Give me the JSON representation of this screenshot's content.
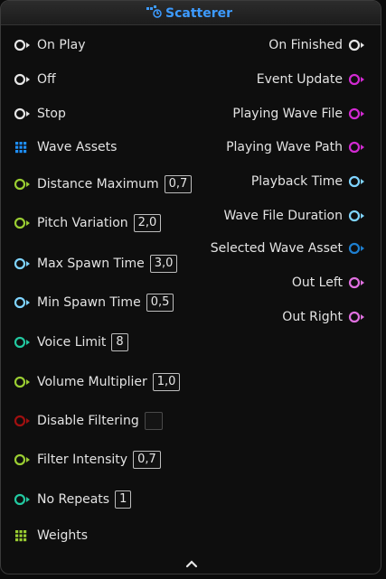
{
  "node": {
    "title": "Scatterer",
    "title_icon": "scatter-icon",
    "inputs": [
      {
        "label": "On Play",
        "pin": "exec",
        "color": "#e6e6e6"
      },
      {
        "label": "Off",
        "pin": "exec",
        "color": "#e6e6e6"
      },
      {
        "label": "Stop",
        "pin": "exec",
        "color": "#e6e6e6"
      },
      {
        "label": "Wave Assets",
        "pin": "array",
        "color": "#1e90ff"
      },
      {
        "label": "Distance Maximum",
        "pin": "float",
        "color": "#9acd32",
        "value": "0,7"
      },
      {
        "label": "Pitch Variation",
        "pin": "float",
        "color": "#9acd32",
        "value": "2,0"
      },
      {
        "label": "Max Spawn Time",
        "pin": "time",
        "color": "#7fd4ff",
        "value": "3,0"
      },
      {
        "label": "Min Spawn Time",
        "pin": "time",
        "color": "#7fd4ff",
        "value": "0,5"
      },
      {
        "label": "Voice Limit",
        "pin": "int",
        "color": "#22c8a0",
        "value": "8"
      },
      {
        "label": "Volume Multiplier",
        "pin": "float",
        "color": "#9acd32",
        "value": "1,0"
      },
      {
        "label": "Disable Filtering",
        "pin": "bool",
        "color": "#a01010",
        "value": ""
      },
      {
        "label": "Filter Intensity",
        "pin": "float",
        "color": "#9acd32",
        "value": "0,7"
      },
      {
        "label": "No Repeats",
        "pin": "int",
        "color": "#22c8a0",
        "value": "1"
      },
      {
        "label": "Weights",
        "pin": "array",
        "color": "#9acd32"
      }
    ],
    "outputs": [
      {
        "label": "On Finished",
        "pin": "exec",
        "color": "#e6e6e6"
      },
      {
        "label": "Event Update",
        "pin": "trigger",
        "color": "#d22ad2"
      },
      {
        "label": "Playing Wave File",
        "pin": "trigger",
        "color": "#d22ad2"
      },
      {
        "label": "Playing Wave Path",
        "pin": "trigger",
        "color": "#d22ad2"
      },
      {
        "label": "Playback Time",
        "pin": "time",
        "color": "#7fd4ff"
      },
      {
        "label": "Wave File Duration",
        "pin": "time",
        "color": "#7fd4ff"
      },
      {
        "label": "Selected Wave Asset",
        "pin": "object",
        "color": "#1e7fd0"
      },
      {
        "label": "Out Left",
        "pin": "audio",
        "color": "#e070e0"
      },
      {
        "label": "Out Right",
        "pin": "audio",
        "color": "#e070e0"
      }
    ],
    "collapse_icon": "chevron-up-icon"
  }
}
